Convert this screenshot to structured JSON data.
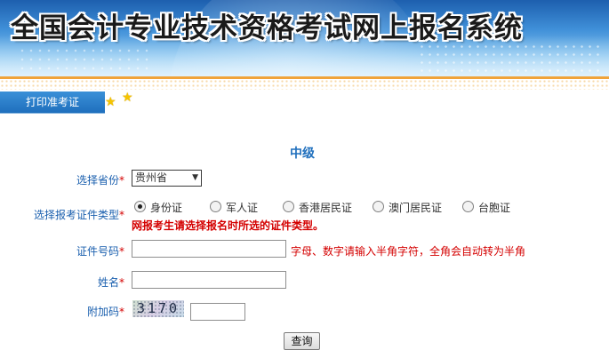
{
  "banner": {
    "title": "全国会计专业技术资格考试网上报名系统"
  },
  "tab": {
    "label": "打印准考证"
  },
  "form": {
    "level": "中级",
    "province": {
      "label": "选择省份",
      "required_mark": "*",
      "value": "贵州省"
    },
    "id_type": {
      "label": "选择报考证件类型",
      "required_mark": "*",
      "options": [
        "身份证",
        "军人证",
        "香港居民证",
        "澳门居民证",
        "台胞证"
      ],
      "selected": "身份证",
      "warning": "网报考生请选择报名时所选的证件类型。"
    },
    "id_number": {
      "label": "证件号码",
      "required_mark": "*",
      "value": "",
      "hint": "字母、数字请输入半角字符，全角会自动转为半角"
    },
    "name": {
      "label": "姓名",
      "required_mark": "*",
      "value": ""
    },
    "captcha": {
      "label": "附加码",
      "required_mark": "*",
      "image_text": "3170",
      "value": ""
    },
    "submit_label": "查询"
  },
  "colors": {
    "banner_blue": "#1f6fbd",
    "label_blue": "#1a5fae",
    "required_red": "#d40000",
    "accent_orange": "#f0a33a"
  }
}
